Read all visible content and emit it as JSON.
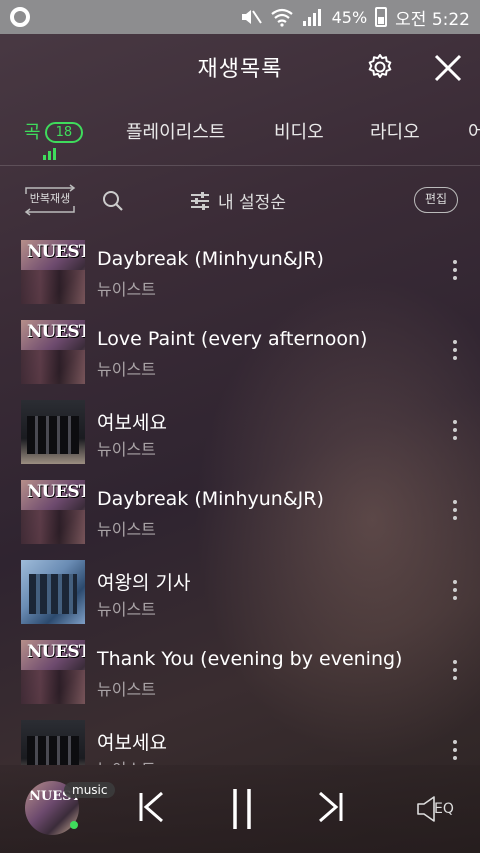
{
  "status_bar": {
    "battery_percent": "45%",
    "time": "오전 5:22"
  },
  "header": {
    "title": "재생목록"
  },
  "tabs": [
    {
      "label": "곡",
      "badge": "18",
      "active": true
    },
    {
      "label": "플레이리스트"
    },
    {
      "label": "비디오"
    },
    {
      "label": "라디오"
    },
    {
      "label": "어"
    }
  ],
  "toolbar": {
    "repeat_label": "반복재생",
    "sort_label": "내 설정순",
    "edit_label": "편집"
  },
  "songs": [
    {
      "title": "Daybreak (Minhyun&JR)",
      "artist": "뉴이스트",
      "cover": "nuest",
      "cover_text": "NUEST"
    },
    {
      "title": "Love Paint (every afternoon)",
      "artist": "뉴이스트",
      "cover": "nuest",
      "cover_text": "NUEST"
    },
    {
      "title": "여보세요",
      "artist": "뉴이스트",
      "cover": "dark"
    },
    {
      "title": "Daybreak (Minhyun&JR)",
      "artist": "뉴이스트",
      "cover": "nuest",
      "cover_text": "NUEST"
    },
    {
      "title": "여왕의 기사",
      "artist": "뉴이스트",
      "cover": "blue"
    },
    {
      "title": "Thank You (evening by evening)",
      "artist": "뉴이스트",
      "cover": "nuest",
      "cover_text": "NUEST"
    },
    {
      "title": "여보세요",
      "artist": "뉴이스트",
      "cover": "dark"
    }
  ],
  "player": {
    "tag": "music",
    "cover_text": "NUEST",
    "eq_label": "EQ"
  },
  "colors": {
    "accent": "#3fdc5c",
    "status_bar": "#8d8d8f"
  }
}
